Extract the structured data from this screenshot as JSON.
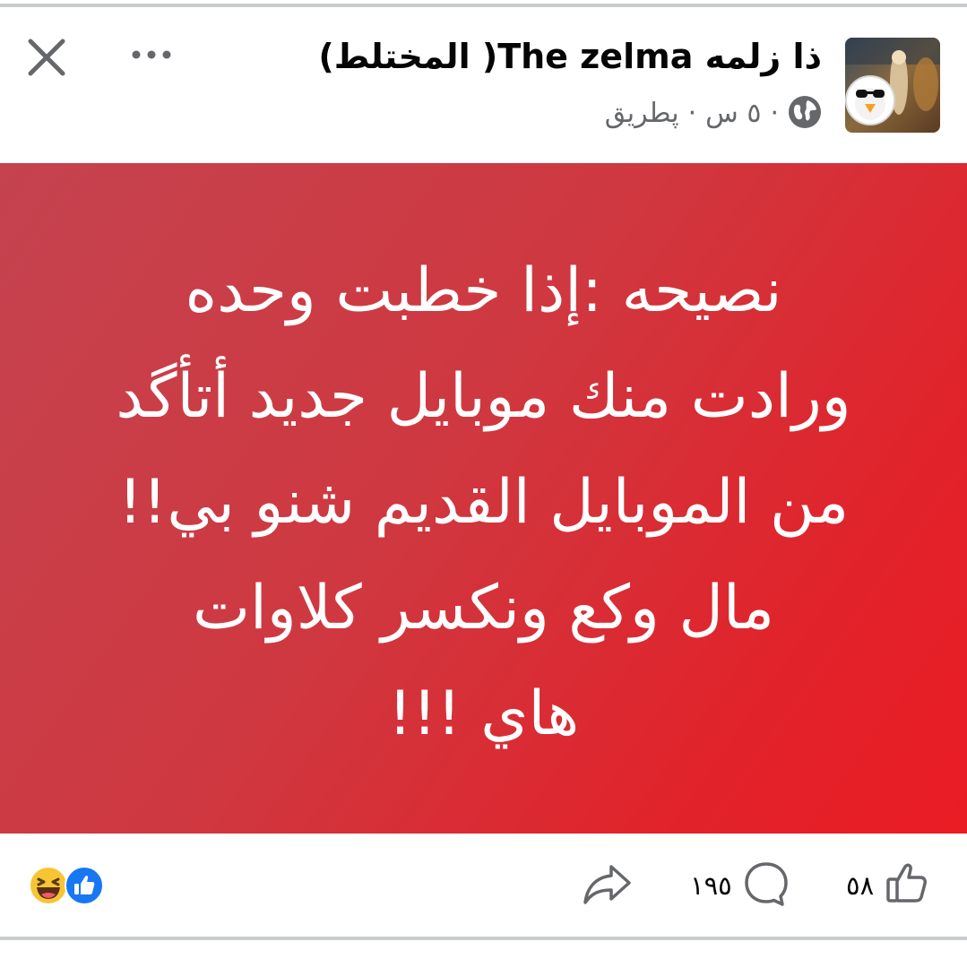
{
  "post": {
    "page_name": "ذا زلمه The zelma( المختلط)",
    "author_label": "پطريق",
    "timestamp": "٥ س",
    "separator": "·",
    "audience_icon": "globe-icon",
    "text_lines": [
      "نصيحه :إذا خطبت وحده",
      "ورادت منك موبايل جديد أتأگد",
      "من الموبايل القديم شنو بي!!",
      "مال وكع ونكسر كلاوات",
      "هاي !!!"
    ],
    "background_colors": [
      "#c4434f",
      "#ea1c24"
    ]
  },
  "header": {
    "close_icon": "close-icon",
    "more_icon": "more-horizontal-icon"
  },
  "footer": {
    "likes_count": "٥٨",
    "comments_count": "١٩٥",
    "like_icon": "thumbs-up-icon",
    "comment_icon": "comment-icon",
    "share_icon": "share-icon",
    "reaction_icons": [
      "haha-reaction-icon",
      "like-reaction-icon"
    ]
  },
  "colors": {
    "like_blue": "#1877f2",
    "secondary_text": "#65676b",
    "post_red": "#e2222a"
  }
}
